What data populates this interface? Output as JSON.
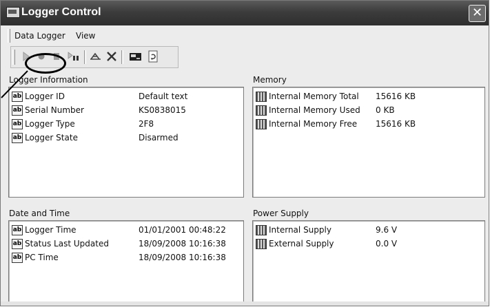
{
  "window": {
    "title": "Logger Control",
    "close_glyph": "✕"
  },
  "menu": {
    "items": [
      "Data Logger",
      "View"
    ]
  },
  "toolbar": {
    "icons": [
      "play-icon",
      "record-icon",
      "stop-icon",
      "play-pause-icon",
      "antenna-icon",
      "delete-icon",
      "card-icon",
      "refresh-icon"
    ]
  },
  "panels": {
    "logger_info": {
      "title": "Logger Information",
      "rows": [
        {
          "label": "Logger ID",
          "value": "Default text"
        },
        {
          "label": "Serial Number",
          "value": "KS0838015"
        },
        {
          "label": "Logger Type",
          "value": "2F8"
        },
        {
          "label": "Logger State",
          "value": "Disarmed"
        }
      ]
    },
    "memory": {
      "title": "Memory",
      "rows": [
        {
          "label": "Internal Memory Total",
          "value": "15616 KB"
        },
        {
          "label": "Internal Memory Used",
          "value": "0 KB"
        },
        {
          "label": "Internal Memory Free",
          "value": "15616 KB"
        }
      ]
    },
    "date_time": {
      "title": "Date and Time",
      "rows": [
        {
          "label": "Logger Time",
          "value": "01/01/2001 00:48:22"
        },
        {
          "label": "Status Last Updated",
          "value": "18/09/2008 10:16:38"
        },
        {
          "label": "PC Time",
          "value": "18/09/2008 10:16:38"
        }
      ]
    },
    "power": {
      "title": "Power Supply",
      "rows": [
        {
          "label": "Internal Supply",
          "value": "9.6 V"
        },
        {
          "label": "External Supply",
          "value": "0.0 V"
        }
      ]
    }
  },
  "icon_text": {
    "ab": "ab"
  },
  "colors": {
    "titlebar": "#3c3c3c",
    "panel_bg": "#ffffff",
    "window_bg": "#ececec"
  }
}
